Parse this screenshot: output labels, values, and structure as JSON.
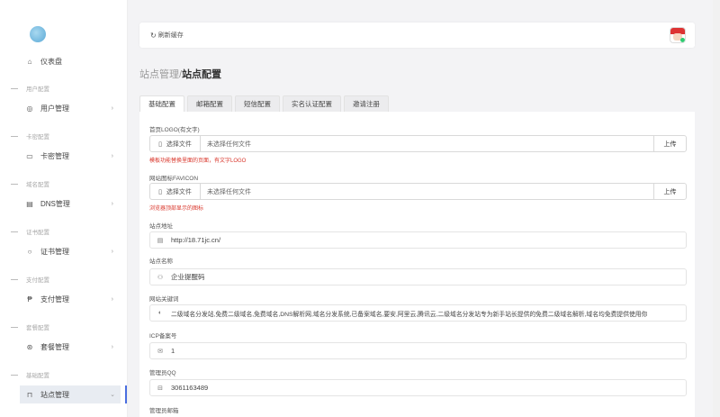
{
  "sidebar": {
    "items": [
      {
        "label": "仪表盘",
        "icon": "home-icon",
        "glyph": "⌂"
      },
      {
        "section": "用户配置"
      },
      {
        "label": "用户管理",
        "icon": "user-icon",
        "glyph": "◎"
      },
      {
        "section": "卡密配置"
      },
      {
        "label": "卡密管理",
        "icon": "monitor-icon",
        "glyph": "▭"
      },
      {
        "section": "域名配置"
      },
      {
        "label": "DNS管理",
        "icon": "calendar-icon",
        "glyph": "▤"
      },
      {
        "section": "证书配置"
      },
      {
        "label": "证书管理",
        "icon": "circle-icon",
        "glyph": "○"
      },
      {
        "section": "支付配置"
      },
      {
        "label": "支付管理",
        "icon": "paypal-icon",
        "glyph": "₱"
      },
      {
        "section": "套餐配置"
      },
      {
        "label": "套餐管理",
        "icon": "package-icon",
        "glyph": "⊛"
      },
      {
        "section": "基础配置"
      },
      {
        "label": "站点管理",
        "icon": "lock-icon",
        "glyph": "⊓"
      }
    ]
  },
  "header": {
    "refresh_label": "刷新缓存",
    "refresh_glyph": "↻"
  },
  "breadcrumb": {
    "parent": "站点管理/",
    "current": "站点配置"
  },
  "tabs": [
    "基础配置",
    "邮箱配置",
    "短信配置",
    "实名认证配置",
    "邀请注册"
  ],
  "form": {
    "logo": {
      "label": "首页LOGO(有文字)",
      "button": "选择文件",
      "empty": "未选择任何文件",
      "upload": "上传",
      "hint": "模板功能替换里面的页面，有文字LOGO"
    },
    "favicon": {
      "label": "网站图标FAVICON",
      "button": "选择文件",
      "empty": "未选择任何文件",
      "upload": "上传",
      "hint": "浏览器顶部显示的图标"
    },
    "site_url": {
      "label": "站点地址",
      "value": "http://18.71jc.cn/",
      "glyph": "▤"
    },
    "site_name": {
      "label": "站点名称",
      "value": "企业提醒码",
      "glyph": "⚇"
    },
    "keywords": {
      "label": "网站关键词",
      "value": "二级域名分发站,免费二级域名,免费域名,DNS解析网,域名分发系统,已备案域名,要安,阿里云,腾讯云,二级域名分发站专为新手站长提供的免费二级域名解析,域名均免费提供使用你",
      "glyph": "◐"
    },
    "icp": {
      "label": "ICP备案号",
      "value": "1",
      "glyph": "✉"
    },
    "qq": {
      "label": "管理员QQ",
      "value": "3061163489",
      "glyph": "⊟"
    },
    "email": {
      "label": "管理员邮箱"
    }
  },
  "colors": {
    "accent": "#4a6ee0",
    "hint": "#d9362b"
  }
}
